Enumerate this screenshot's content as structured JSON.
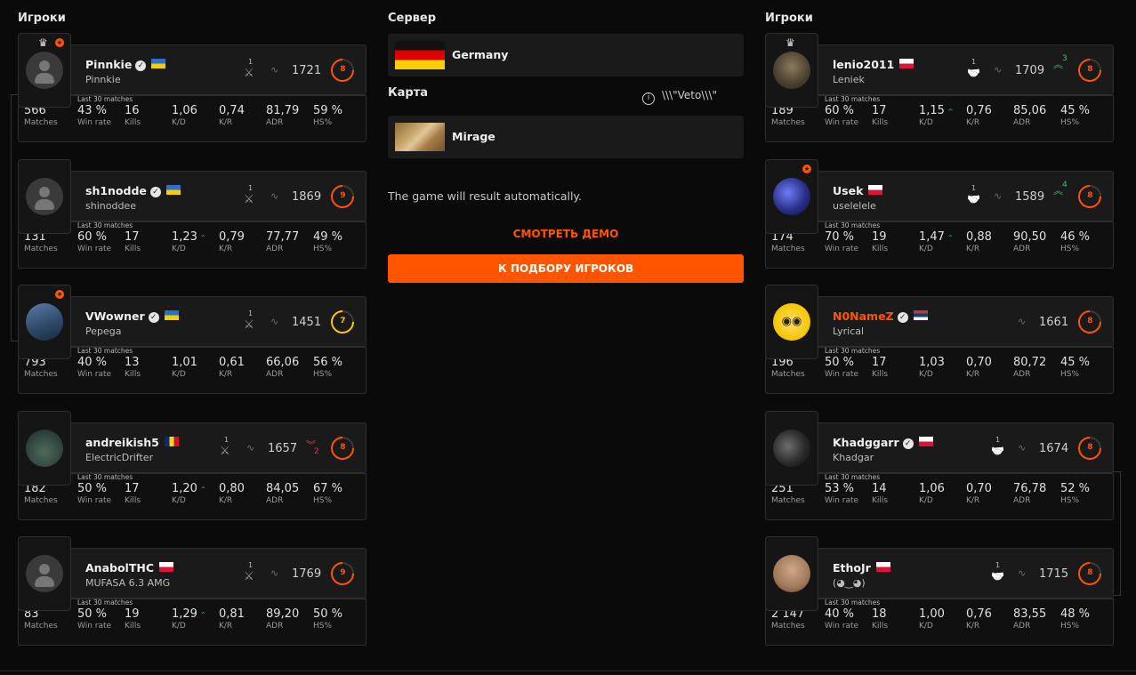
{
  "left_heading": "Игроки",
  "right_heading": "Игроки",
  "center": {
    "server_heading": "Сервер",
    "server_name": "Germany",
    "map_heading": "Карта",
    "veto_text": "\\\\\\\"Veto\\\\\\\"",
    "map_name": "Mirage",
    "result_text": "The game will result automatically.",
    "watch_demo": "СМОТРЕТЬ ДЕМО",
    "matchmaking_button": "К ПОДБОРУ ИГРОКОВ"
  },
  "labels": {
    "last30": "Last 30 matches",
    "matches": "Matches",
    "winrate": "Win rate",
    "kills": "Kills",
    "kd": "K/D",
    "kr": "K/R",
    "adr": "ADR",
    "hs": "HS%"
  },
  "left_team": [
    {
      "nick": "Pinnkie",
      "flag": "ua",
      "name": "Pinnkie",
      "party": "1",
      "elo": "1721",
      "level": "8",
      "matches": "566",
      "winrate": "43 %",
      "kills": "16",
      "kd": "1,06",
      "kr": "0,74",
      "adr": "81,79",
      "hs": "59 %"
    },
    {
      "nick": "sh1nodde",
      "flag": "ua",
      "name": "shinoddee",
      "party": "1",
      "elo": "1869",
      "level": "9",
      "matches": "131",
      "winrate": "60 %",
      "kills": "17",
      "kd": "1,23",
      "kr": "0,79",
      "adr": "77,77",
      "hs": "49 %"
    },
    {
      "nick": "VWowner",
      "flag": "ua",
      "name": "Pepega",
      "party": "1",
      "elo": "1451",
      "level": "7",
      "matches": "793",
      "winrate": "40 %",
      "kills": "13",
      "kd": "1,01",
      "kr": "0,61",
      "adr": "66,06",
      "hs": "56 %"
    },
    {
      "nick": "andreikish5",
      "flag": "ro",
      "name": "ElectricDrifter",
      "party": "1",
      "elo": "1657",
      "elo_change": "2",
      "level": "8",
      "matches": "182",
      "winrate": "50 %",
      "kills": "17",
      "kd": "1,20",
      "kr": "0,80",
      "adr": "84,05",
      "hs": "67 %"
    },
    {
      "nick": "AnabolTHC",
      "flag": "pl",
      "name": "MUFASA 6.3 AMG",
      "party": "1",
      "elo": "1769",
      "level": "9",
      "matches": "83",
      "winrate": "50 %",
      "kills": "19",
      "kd": "1,29",
      "kr": "0,81",
      "adr": "89,20",
      "hs": "50 %"
    }
  ],
  "right_team": [
    {
      "nick": "lenio2011",
      "flag": "pl",
      "name": "Leniek",
      "party": "1",
      "elo": "1709",
      "elo_change": "3",
      "level": "8",
      "matches": "189",
      "winrate": "60 %",
      "kills": "17",
      "kd": "1,15",
      "kr": "0,76",
      "adr": "85,06",
      "hs": "45 %"
    },
    {
      "nick": "Usek",
      "flag": "pl",
      "name": "uselelele",
      "party": "1",
      "elo": "1589",
      "elo_change": "4",
      "level": "8",
      "matches": "174",
      "winrate": "70 %",
      "kills": "19",
      "kd": "1,47",
      "kr": "0,88",
      "adr": "90,50",
      "hs": "46 %"
    },
    {
      "nick": "N0NameZ",
      "flag": "rs",
      "name": "Lyrical",
      "elo": "1661",
      "level": "8",
      "matches": "196",
      "winrate": "50 %",
      "kills": "17",
      "kd": "1,03",
      "kr": "0,70",
      "adr": "80,72",
      "hs": "45 %"
    },
    {
      "nick": "Khadggarr",
      "flag": "pl",
      "name": "Khadgar",
      "party": "1",
      "elo": "1674",
      "level": "8",
      "matches": "251",
      "winrate": "53 %",
      "kills": "14",
      "kd": "1,06",
      "kr": "0,70",
      "adr": "76,78",
      "hs": "52 %"
    },
    {
      "nick": "EthoJr",
      "flag": "pl",
      "name": "(◕‿◕)",
      "party": "1",
      "elo": "1715",
      "level": "8",
      "matches": "2 147",
      "winrate": "40 %",
      "kills": "18",
      "kd": "1,00",
      "kr": "0,76",
      "adr": "83,55",
      "hs": "48 %"
    }
  ],
  "colors": {
    "accent": "#ff5500",
    "up": "#3fc36a",
    "down": "#e0393e",
    "level7": "#ffc800"
  },
  "icons": {
    "party": "crossed-swords-icon",
    "party_right": "handshake-icon",
    "trend": "trend-line-icon",
    "crown": "crown-icon",
    "info": "info-icon",
    "verified": "verified-check-icon"
  }
}
